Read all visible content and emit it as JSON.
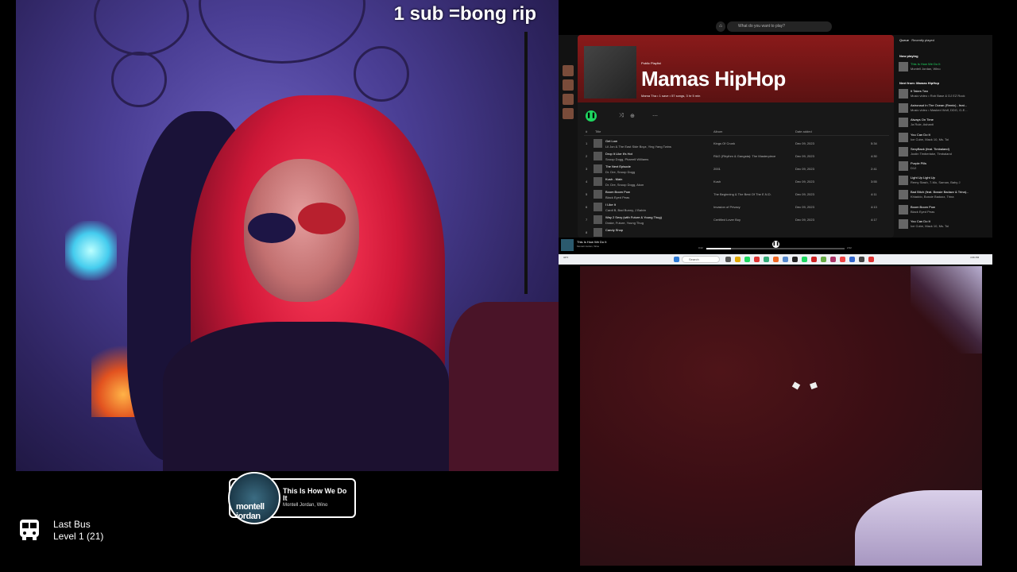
{
  "overlay": {
    "sub_text": "1 sub =bong rip"
  },
  "now_playing_widget": {
    "title": "This Is How We Do It",
    "artist": "Montell Jordan, Wino",
    "art_text": "montell jordan"
  },
  "last_bus": {
    "name": "Last Bus",
    "level": "Level 1  (21)"
  },
  "spotify": {
    "search_placeholder": "What do you want to play?",
    "playlist_type": "Public Playlist",
    "playlist_title": "Mamas HipHop",
    "playlist_meta": "Mama Tha • 1 save • 57 songs, 3 hr 5 min",
    "columns": {
      "num": "#",
      "title": "Title",
      "album": "Album",
      "date": "Date added"
    },
    "tracks": [
      {
        "n": "1",
        "title": "Get Low",
        "artist": "Lil Jon & The East Side Boyz, Ying Yang Twins",
        "album": "Kings Of Crunk",
        "date": "Dec 09, 2023",
        "dur": "5:34"
      },
      {
        "n": "2",
        "title": "Drop It Like It's Hot",
        "artist": "Snoop Dogg, Pharrell Williams",
        "album": "R&G (Rhythm & Gangsta): The Masterpiece",
        "date": "Dec 09, 2023",
        "dur": "4:30"
      },
      {
        "n": "3",
        "title": "The Next Episode",
        "artist": "Dr. Dre, Snoop Dogg",
        "album": "2001",
        "date": "Dec 09, 2023",
        "dur": "2:41"
      },
      {
        "n": "4",
        "title": "Kush - Main",
        "artist": "Dr. Dre, Snoop Dogg, Akon",
        "album": "Kush",
        "date": "Dec 09, 2023",
        "dur": "3:55"
      },
      {
        "n": "5",
        "title": "Boom Boom Pow",
        "artist": "Black Eyed Peas",
        "album": "The Beginning & The Best Of The E.N.D.",
        "date": "Dec 09, 2023",
        "dur": "4:11"
      },
      {
        "n": "6",
        "title": "I Like It",
        "artist": "Cardi B, Bad Bunny, J Balvin",
        "album": "Invasion of Privacy",
        "date": "Dec 09, 2023",
        "dur": "4:13"
      },
      {
        "n": "7",
        "title": "Way 2 Sexy (with Future & Young Thug)",
        "artist": "Drake, Future, Young Thug",
        "album": "Certified Lover Boy",
        "date": "Dec 09, 2023",
        "dur": "4:17"
      },
      {
        "n": "8",
        "title": "Candy Shop",
        "artist": "",
        "album": "",
        "date": "",
        "dur": ""
      }
    ],
    "queue_tabs": {
      "queue": "Queue",
      "recent": "Recently played"
    },
    "now_playing_label": "Now playing",
    "now_playing": {
      "title": "This Is How We Do It",
      "artist": "Montell Jordan, Wino"
    },
    "next_from_label": "Next from: Mamas HipHop",
    "queue": [
      {
        "title": "It Takes Two",
        "artist": "Music video • Rob Base & DJ EZ Rock"
      },
      {
        "title": "Astronaut In The Ocean (Remix) - feat...",
        "artist": "Music video • Masked Wolf, DDG, G-E..."
      },
      {
        "title": "Always On Time",
        "artist": "Ja Rule, Ashanti"
      },
      {
        "title": "You Can Do It",
        "artist": "Ice Cube, Mack 10, Ms. Toi"
      },
      {
        "title": "SexyBack (feat. Timbaland)",
        "artist": "Justin Timberlake, Timbaland"
      },
      {
        "title": "Purple Pills",
        "artist": "D12"
      },
      {
        "title": "Light Up Light Up",
        "artist": "Remy Stash, 7-Mo, Saman, Baby J"
      },
      {
        "title": "Bad Bitch (feat. Bossie Badazz & Trina)...",
        "artist": "Khiaddo, Bossie Badazz, Trina"
      },
      {
        "title": "Boom Boom Pow",
        "artist": "Black Eyed Peas"
      },
      {
        "title": "You Can Do It",
        "artist": "Ice Cube, Mack 10, Ms. Toi"
      }
    ],
    "player": {
      "title": "This Is How We Do It",
      "artist": "Montell Jordan, Wino",
      "elapsed": "0:22",
      "total": "2:02",
      "progress": 0.18
    }
  },
  "taskbar": {
    "weather": "34°F",
    "search_placeholder": "Search",
    "time": "4:36 PM"
  }
}
